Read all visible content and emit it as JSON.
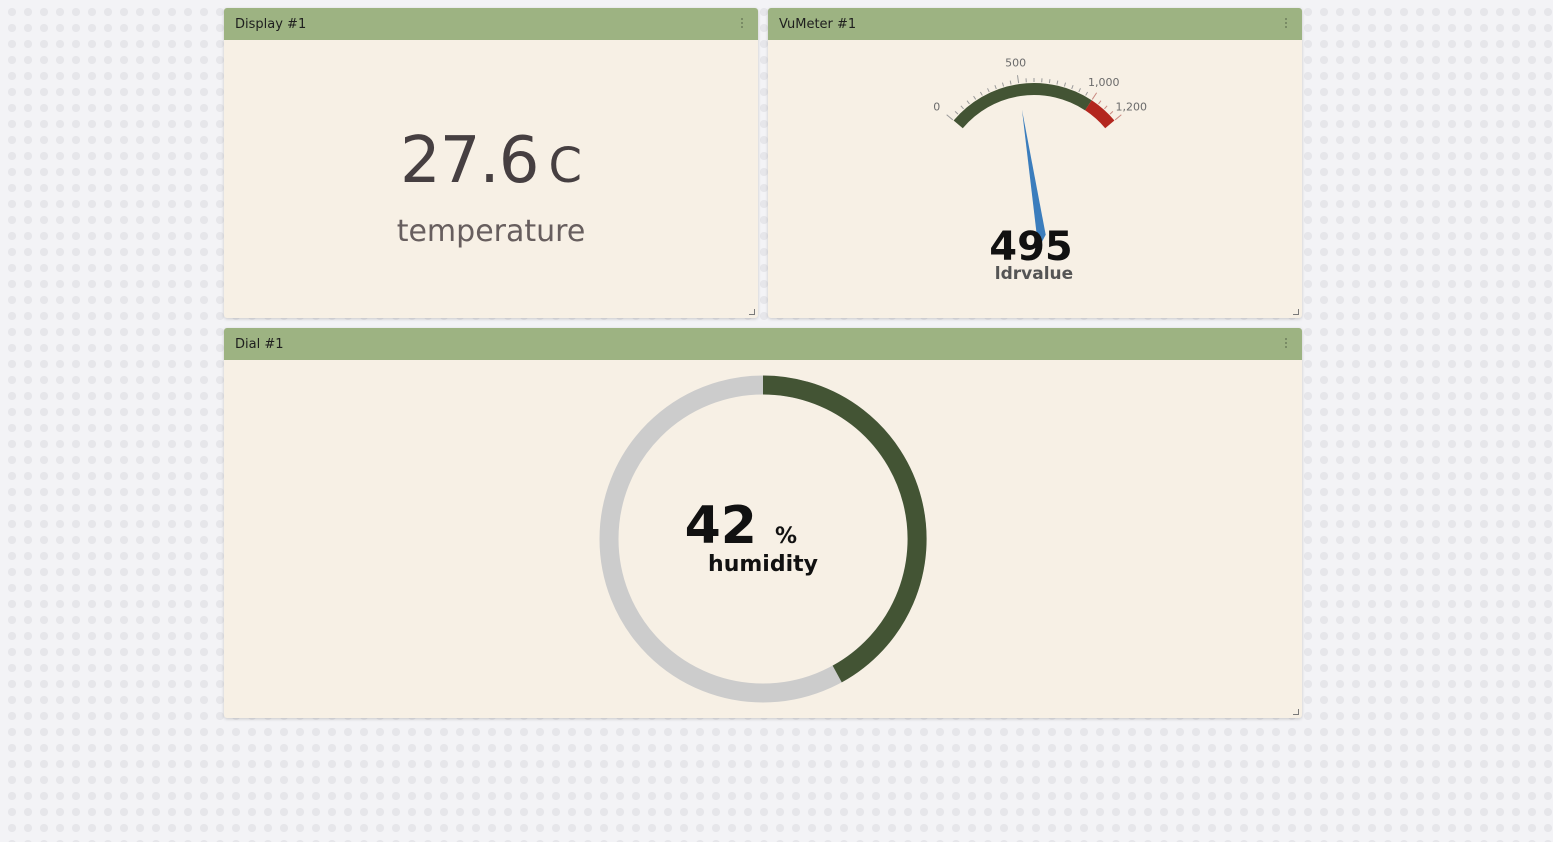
{
  "widgets": {
    "display": {
      "title": "Display #1",
      "value": "27.6",
      "unit": "C",
      "label": "temperature"
    },
    "vumeter": {
      "title": "VuMeter #1",
      "value": "495",
      "label": "ldrvalue",
      "ticks": [
        "0",
        "500",
        "1,000",
        "1,200"
      ],
      "gauge": {
        "min": 0,
        "max": 1200,
        "value": 495,
        "alarm_from": 1000
      }
    },
    "dial": {
      "title": "Dial #1",
      "value": "42",
      "unit": "%",
      "label": "humidity",
      "percent": 42
    }
  },
  "colors": {
    "header": "#9db382",
    "panel": "#f7f0e5",
    "gauge_fill": "#435434",
    "gauge_alarm": "#b3261e",
    "needle": "#3b7dbd",
    "dial_track": "#cccccc"
  },
  "icons": {
    "widget_menu": "vertical-ellipsis-icon",
    "resize": "resize-corner-icon"
  }
}
